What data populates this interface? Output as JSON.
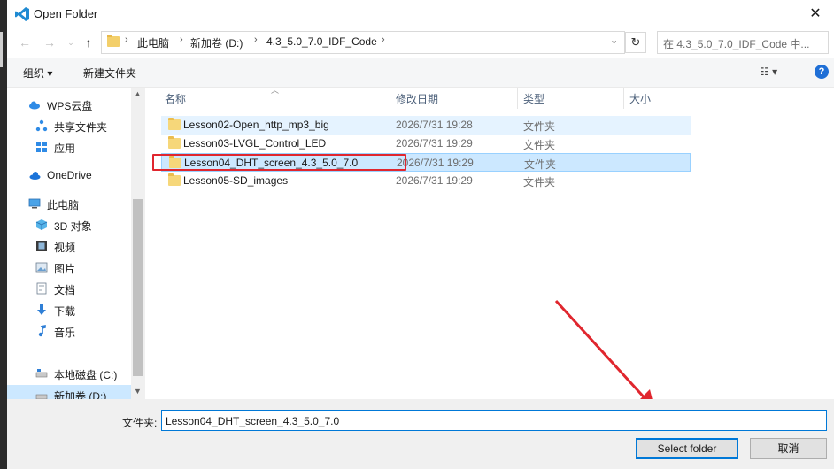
{
  "window": {
    "title": "Open Folder"
  },
  "address": {
    "crumbs": [
      "此电脑",
      "新加卷 (D:)",
      "4.3_5.0_7.0_IDF_Code"
    ]
  },
  "search": {
    "placeholder": "在 4.3_5.0_7.0_IDF_Code 中..."
  },
  "toolbar": {
    "organize": "组织 ▾",
    "new_folder": "新建文件夹"
  },
  "sidebar": {
    "items": [
      {
        "label": "WPS云盘",
        "icon": "cloud-icon"
      },
      {
        "label": "共享文件夹",
        "icon": "share-icon"
      },
      {
        "label": "应用",
        "icon": "apps-icon"
      },
      {
        "label": "OneDrive",
        "icon": "onedrive-icon"
      },
      {
        "label": "此电脑",
        "icon": "computer-icon"
      },
      {
        "label": "3D 对象",
        "icon": "cube-icon"
      },
      {
        "label": "视频",
        "icon": "video-icon"
      },
      {
        "label": "图片",
        "icon": "picture-icon"
      },
      {
        "label": "文档",
        "icon": "document-icon"
      },
      {
        "label": "下载",
        "icon": "download-icon"
      },
      {
        "label": "音乐",
        "icon": "music-icon"
      },
      {
        "label": "本地磁盘 (C:)",
        "icon": "drive-icon"
      },
      {
        "label": "新加卷 (D:)",
        "icon": "drive-icon",
        "selected": true
      }
    ]
  },
  "columns": {
    "name": "名称",
    "date": "修改日期",
    "type": "类型",
    "size": "大小"
  },
  "files": [
    {
      "name": "Lesson02-Open_http_mp3_big",
      "date": "2026/7/31 19:28",
      "type": "文件夹"
    },
    {
      "name": "Lesson03-LVGL_Control_LED",
      "date": "2026/7/31 19:29",
      "type": "文件夹"
    },
    {
      "name": "Lesson04_DHT_screen_4.3_5.0_7.0",
      "date": "2026/7/31 19:29",
      "type": "文件夹",
      "selected": true
    },
    {
      "name": "Lesson05-SD_images",
      "date": "2026/7/31 19:29",
      "type": "文件夹"
    }
  ],
  "footer": {
    "folder_label": "文件夹:",
    "folder_value": "Lesson04_DHT_screen_4.3_5.0_7.0",
    "select_button": "Select folder",
    "cancel_button": "取消"
  },
  "colors": {
    "accent": "#0078d7",
    "annotation": "#e0262e",
    "selection": "#cce8ff"
  }
}
